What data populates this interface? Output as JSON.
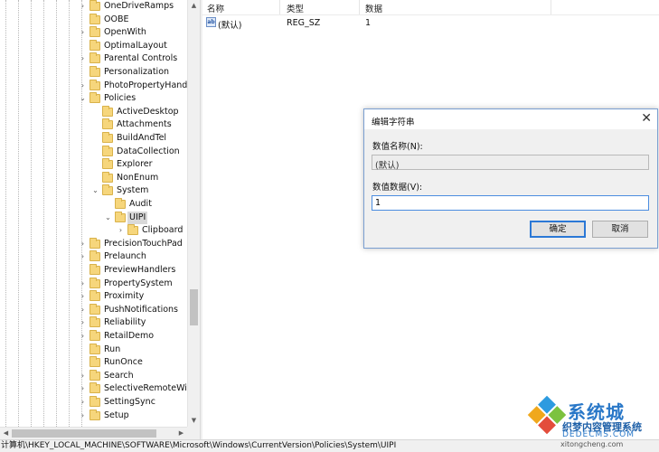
{
  "tree": {
    "items": [
      {
        "label": "OneDriveRamps",
        "depth": 0,
        "expander": "collapsed",
        "selected": false
      },
      {
        "label": "OOBE",
        "depth": 0,
        "expander": "none",
        "selected": false
      },
      {
        "label": "OpenWith",
        "depth": 0,
        "expander": "collapsed",
        "selected": false
      },
      {
        "label": "OptimalLayout",
        "depth": 0,
        "expander": "none",
        "selected": false
      },
      {
        "label": "Parental Controls",
        "depth": 0,
        "expander": "collapsed",
        "selected": false
      },
      {
        "label": "Personalization",
        "depth": 0,
        "expander": "none",
        "selected": false
      },
      {
        "label": "PhotoPropertyHandle",
        "depth": 0,
        "expander": "collapsed",
        "selected": false
      },
      {
        "label": "Policies",
        "depth": 0,
        "expander": "expanded",
        "selected": false
      },
      {
        "label": "ActiveDesktop",
        "depth": 1,
        "expander": "none",
        "selected": false
      },
      {
        "label": "Attachments",
        "depth": 1,
        "expander": "none",
        "selected": false
      },
      {
        "label": "BuildAndTel",
        "depth": 1,
        "expander": "none",
        "selected": false
      },
      {
        "label": "DataCollection",
        "depth": 1,
        "expander": "none",
        "selected": false
      },
      {
        "label": "Explorer",
        "depth": 1,
        "expander": "none",
        "selected": false
      },
      {
        "label": "NonEnum",
        "depth": 1,
        "expander": "none",
        "selected": false
      },
      {
        "label": "System",
        "depth": 1,
        "expander": "expanded",
        "selected": false
      },
      {
        "label": "Audit",
        "depth": 2,
        "expander": "none",
        "selected": false
      },
      {
        "label": "UIPI",
        "depth": 2,
        "expander": "expanded",
        "selected": true
      },
      {
        "label": "Clipboard",
        "depth": 3,
        "expander": "collapsed",
        "selected": false
      },
      {
        "label": "PrecisionTouchPad",
        "depth": 0,
        "expander": "collapsed",
        "selected": false
      },
      {
        "label": "Prelaunch",
        "depth": 0,
        "expander": "collapsed",
        "selected": false
      },
      {
        "label": "PreviewHandlers",
        "depth": 0,
        "expander": "none",
        "selected": false
      },
      {
        "label": "PropertySystem",
        "depth": 0,
        "expander": "collapsed",
        "selected": false
      },
      {
        "label": "Proximity",
        "depth": 0,
        "expander": "collapsed",
        "selected": false
      },
      {
        "label": "PushNotifications",
        "depth": 0,
        "expander": "collapsed",
        "selected": false
      },
      {
        "label": "Reliability",
        "depth": 0,
        "expander": "collapsed",
        "selected": false
      },
      {
        "label": "RetailDemo",
        "depth": 0,
        "expander": "collapsed",
        "selected": false
      },
      {
        "label": "Run",
        "depth": 0,
        "expander": "none",
        "selected": false
      },
      {
        "label": "RunOnce",
        "depth": 0,
        "expander": "none",
        "selected": false
      },
      {
        "label": "Search",
        "depth": 0,
        "expander": "collapsed",
        "selected": false
      },
      {
        "label": "SelectiveRemoteWipe",
        "depth": 0,
        "expander": "collapsed",
        "selected": false
      },
      {
        "label": "SettingSync",
        "depth": 0,
        "expander": "collapsed",
        "selected": false
      },
      {
        "label": "Setup",
        "depth": 0,
        "expander": "collapsed",
        "selected": false
      }
    ]
  },
  "list": {
    "columns": [
      "名称",
      "类型",
      "数据"
    ],
    "rows": [
      {
        "icon": "string-value-icon",
        "name": "(默认)",
        "type": "REG_SZ",
        "data": "1"
      }
    ]
  },
  "status_path": "计算机\\HKEY_LOCAL_MACHINE\\SOFTWARE\\Microsoft\\Windows\\CurrentVersion\\Policies\\System\\UIPI",
  "dialog": {
    "title": "编辑字符串",
    "close_glyph": "✕",
    "name_label": "数值名称(N):",
    "name_value": "(默认)",
    "data_label": "数值数据(V):",
    "data_value": "1",
    "ok_label": "确定",
    "cancel_label": "取消"
  },
  "watermark": {
    "big_text": "系统城",
    "sub_text": "织梦内容管理系统",
    "domain": "DEDECMS.COM",
    "url": "xitongcheng.com"
  },
  "colors": {
    "accent": "#2b78d6",
    "folder": "#f6d67c",
    "selection": "#d9d9d9"
  }
}
